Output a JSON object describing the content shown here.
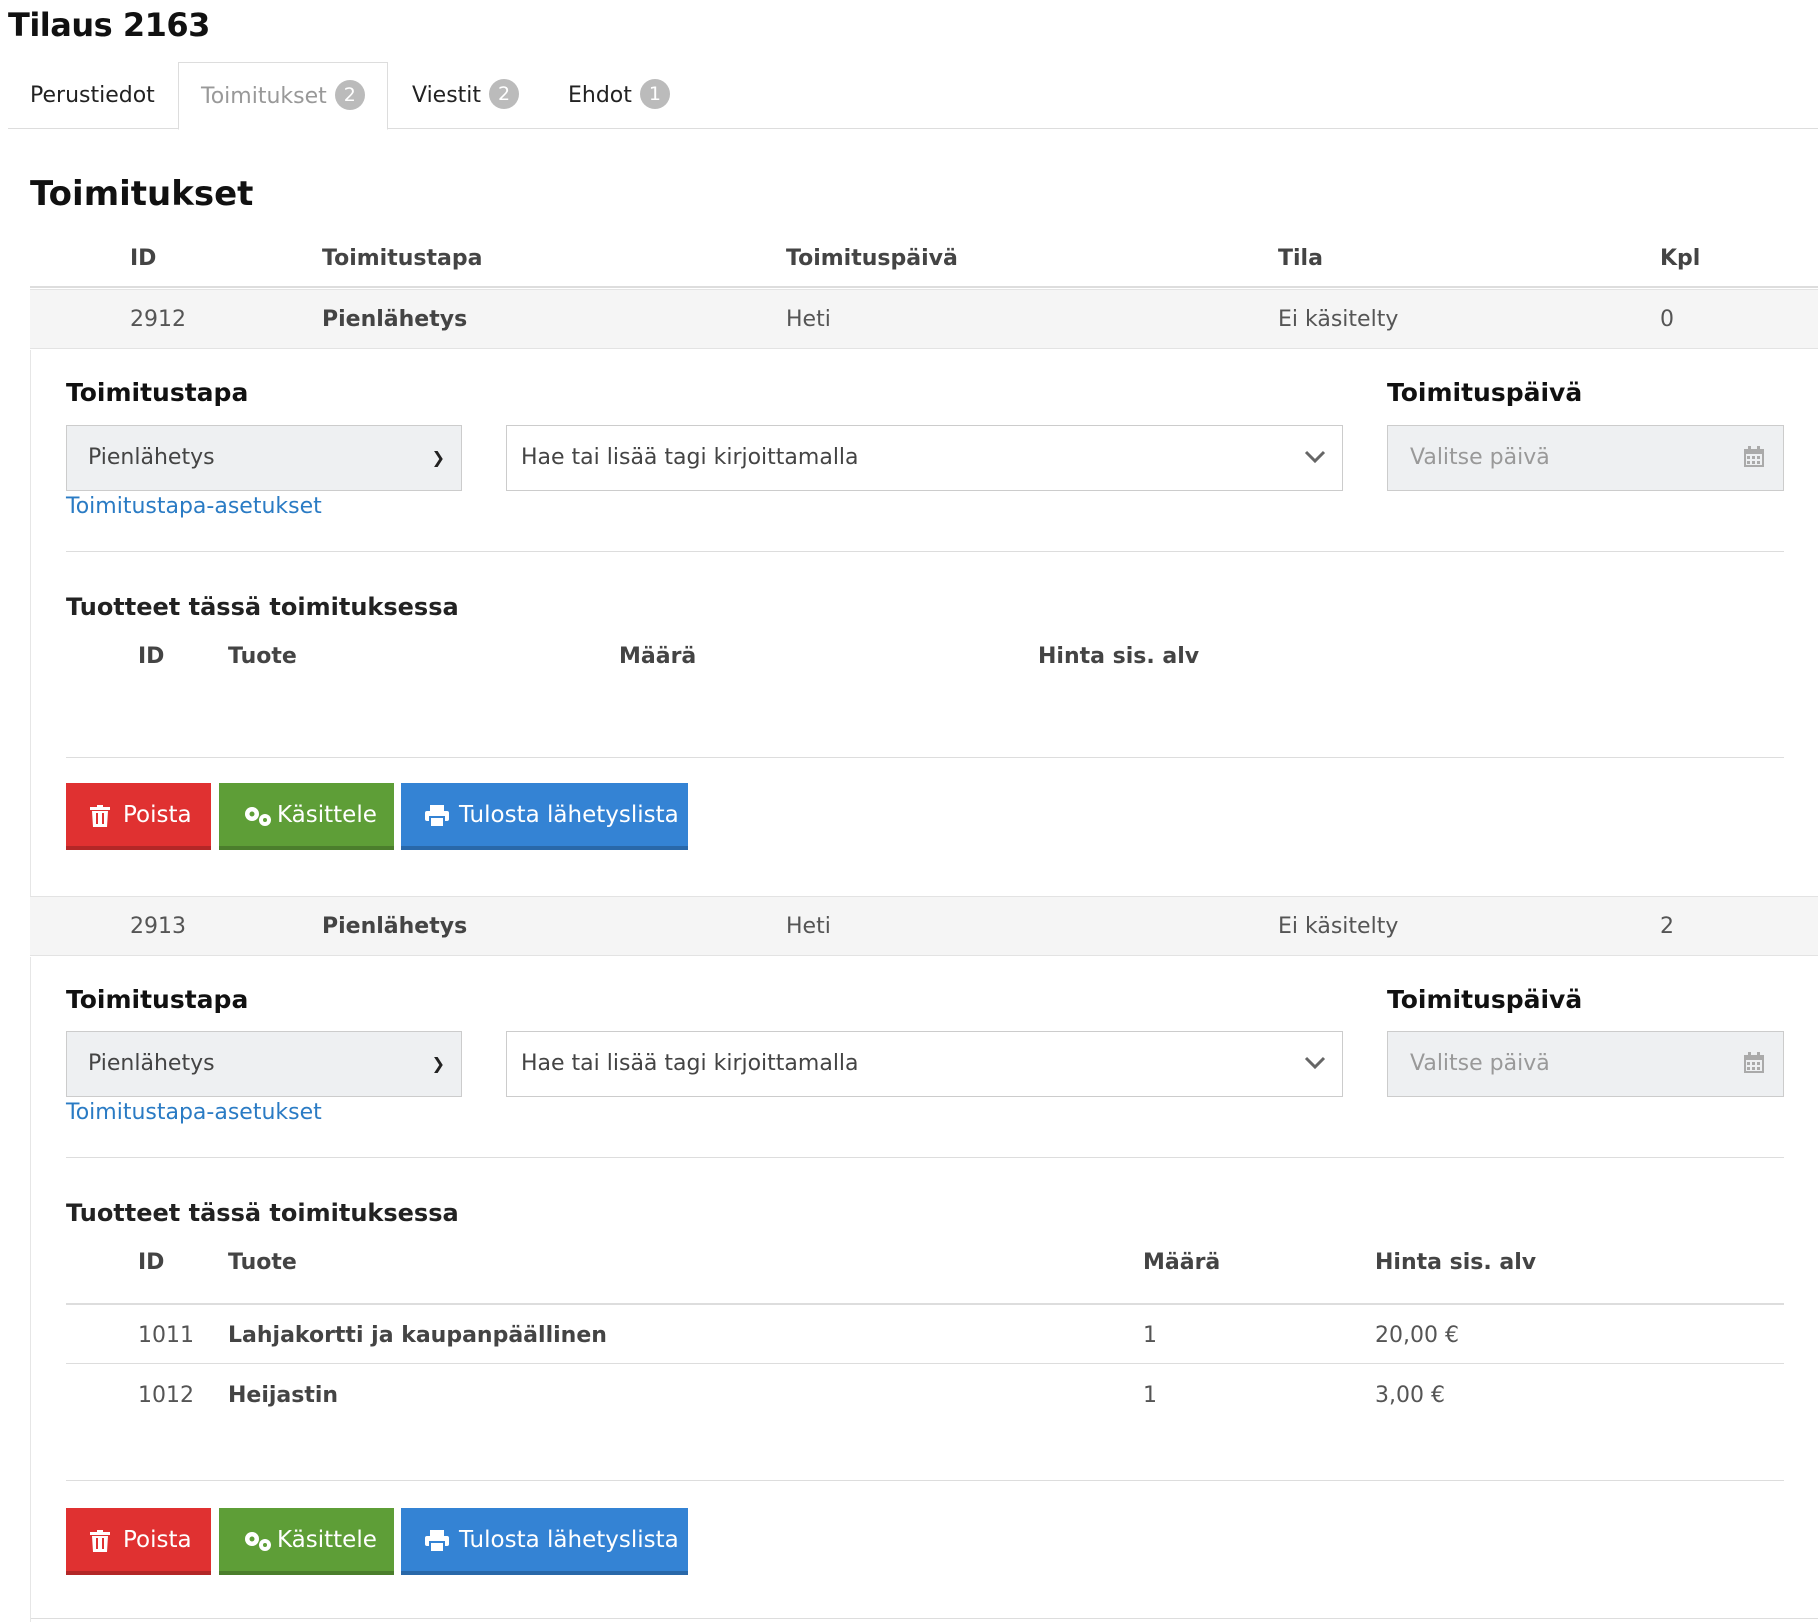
{
  "page": {
    "title": "Tilaus 2163"
  },
  "tabs": [
    {
      "label": "Perustiedot"
    },
    {
      "label": "Toimitukset",
      "badge": "2"
    },
    {
      "label": "Viestit",
      "badge": "2"
    },
    {
      "label": "Ehdot",
      "badge": "1"
    }
  ],
  "section": {
    "title": "Toimitukset"
  },
  "table": {
    "headers": {
      "id": "ID",
      "method": "Toimitustapa",
      "date": "Toimituspäivä",
      "status": "Tila",
      "qty": "Kpl"
    }
  },
  "deliveries": [
    {
      "id": "2912",
      "method": "Pienlähetys",
      "date": "Heti",
      "status": "Ei käsitelty",
      "qty": "0",
      "method_label": "Toimitustapa",
      "method_value": "Pienlähetys",
      "tag_placeholder": "Hae tai lisää tagi kirjoittamalla",
      "date_label": "Toimituspäivä",
      "date_placeholder": "Valitse päivä",
      "settings_link": "Toimitustapa-asetukset",
      "products_title": "Tuotteet tässä toimituksessa",
      "product_headers": {
        "id": "ID",
        "product": "Tuote",
        "qty": "Määrä",
        "price": "Hinta sis. alv"
      },
      "products": [],
      "buttons": {
        "delete": "Poista",
        "process": "Käsittele",
        "print": "Tulosta lähetyslista"
      }
    },
    {
      "id": "2913",
      "method": "Pienlähetys",
      "date": "Heti",
      "status": "Ei käsitelty",
      "qty": "2",
      "method_label": "Toimitustapa",
      "method_value": "Pienlähetys",
      "tag_placeholder": "Hae tai lisää tagi kirjoittamalla",
      "date_label": "Toimituspäivä",
      "date_placeholder": "Valitse päivä",
      "settings_link": "Toimitustapa-asetukset",
      "products_title": "Tuotteet tässä toimituksessa",
      "product_headers": {
        "id": "ID",
        "product": "Tuote",
        "qty": "Määrä",
        "price": "Hinta sis. alv"
      },
      "products": [
        {
          "id": "1011",
          "name": "Lahjakortti ja kaupanpäällinen",
          "qty": "1",
          "price": "20,00 €"
        },
        {
          "id": "1012",
          "name": "Heijastin",
          "qty": "1",
          "price": "3,00 €"
        }
      ],
      "buttons": {
        "delete": "Poista",
        "process": "Käsittele",
        "print": "Tulosta lähetyslista"
      }
    }
  ],
  "icons": {
    "trash": "trash-icon",
    "gears": "gears-icon",
    "print": "print-icon",
    "calendar": "calendar-icon",
    "chevron": "chevron-down-icon"
  }
}
